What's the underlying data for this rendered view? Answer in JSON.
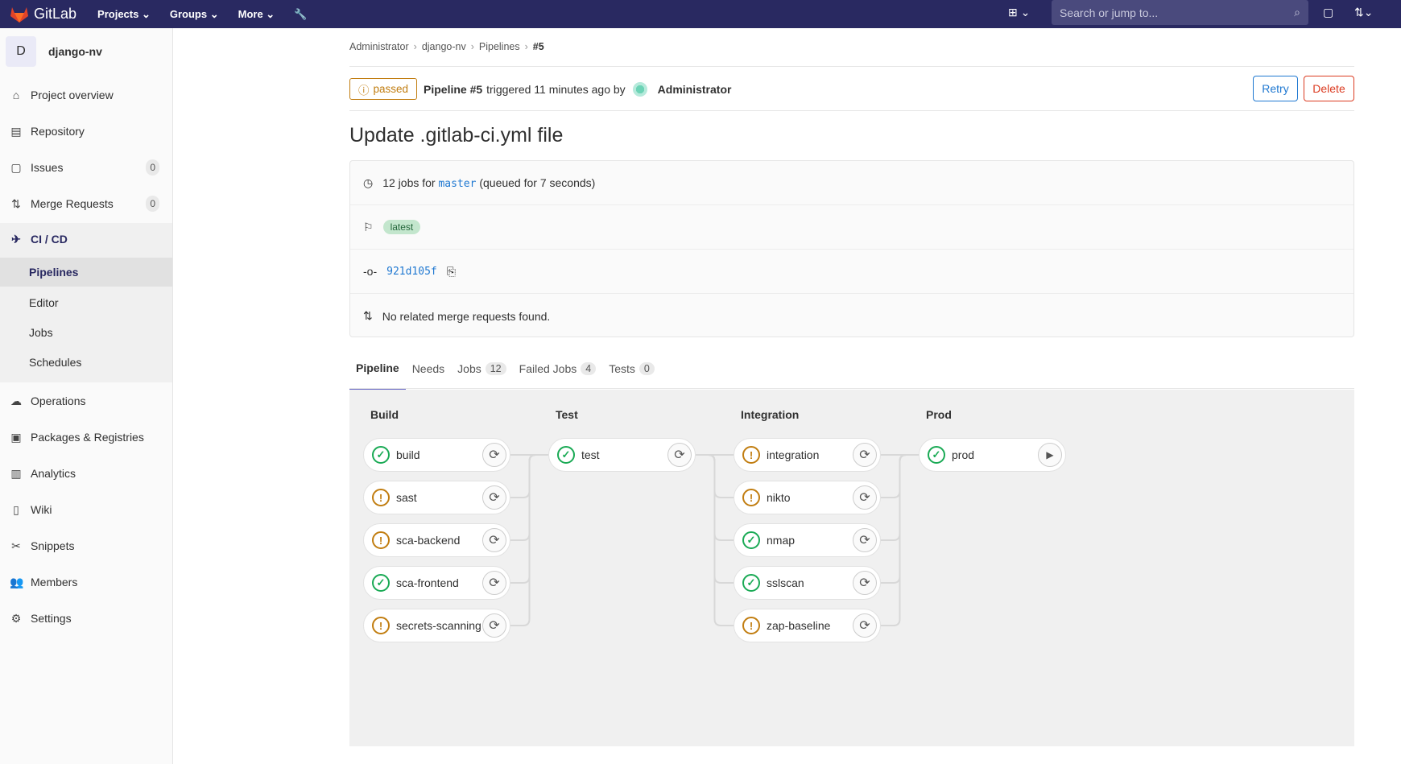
{
  "topbar": {
    "brand": "GitLab",
    "nav": [
      "Projects",
      "Groups",
      "More"
    ],
    "search_placeholder": "Search or jump to..."
  },
  "sidebar": {
    "project_initial": "D",
    "project_name": "django-nv",
    "items": [
      {
        "label": "Project overview",
        "icon": "home-icon"
      },
      {
        "label": "Repository",
        "icon": "doc-icon"
      },
      {
        "label": "Issues",
        "icon": "issues-icon",
        "count": "0"
      },
      {
        "label": "Merge Requests",
        "icon": "merge-request-icon",
        "count": "0"
      },
      {
        "label": "CI / CD",
        "icon": "rocket-icon"
      }
    ],
    "ci_sub": [
      "Pipelines",
      "Editor",
      "Jobs",
      "Schedules"
    ],
    "items2": [
      {
        "label": "Operations",
        "icon": "cloud-gear-icon"
      },
      {
        "label": "Packages & Registries",
        "icon": "package-icon"
      },
      {
        "label": "Analytics",
        "icon": "chart-icon"
      },
      {
        "label": "Wiki",
        "icon": "book-icon"
      },
      {
        "label": "Snippets",
        "icon": "scissors-icon"
      },
      {
        "label": "Members",
        "icon": "users-icon"
      },
      {
        "label": "Settings",
        "icon": "gear-icon"
      }
    ]
  },
  "breadcrumb": [
    "Administrator",
    "django-nv",
    "Pipelines",
    "#5"
  ],
  "header": {
    "status": "passed",
    "pipeline": "Pipeline #5",
    "triggered": "triggered 11 minutes ago by",
    "user": "Administrator",
    "retry": "Retry",
    "delete": "Delete"
  },
  "title": "Update .gitlab-ci.yml file",
  "info": {
    "jobs_count": "12 jobs for",
    "branch": "master",
    "queued": "(queued for 7 seconds)",
    "tag": "latest",
    "commit": "921d105f",
    "mr": "No related merge requests found."
  },
  "tabs": [
    {
      "label": "Pipeline"
    },
    {
      "label": "Needs"
    },
    {
      "label": "Jobs",
      "count": "12"
    },
    {
      "label": "Failed Jobs",
      "count": "4"
    },
    {
      "label": "Tests",
      "count": "0"
    }
  ],
  "stages": [
    {
      "name": "Build",
      "jobs": [
        {
          "name": "build",
          "status": "success"
        },
        {
          "name": "sast",
          "status": "warning"
        },
        {
          "name": "sca-backend",
          "status": "warning"
        },
        {
          "name": "sca-frontend",
          "status": "success"
        },
        {
          "name": "secrets-scanning",
          "status": "warning"
        }
      ]
    },
    {
      "name": "Test",
      "jobs": [
        {
          "name": "test",
          "status": "success"
        }
      ]
    },
    {
      "name": "Integration",
      "jobs": [
        {
          "name": "integration",
          "status": "warning"
        },
        {
          "name": "nikto",
          "status": "warning"
        },
        {
          "name": "nmap",
          "status": "success"
        },
        {
          "name": "sslscan",
          "status": "success"
        },
        {
          "name": "zap-baseline",
          "status": "warning"
        }
      ]
    },
    {
      "name": "Prod",
      "jobs": [
        {
          "name": "prod",
          "status": "success",
          "action": "play"
        }
      ]
    }
  ],
  "colors": {
    "topbar": "#292961",
    "success": "#1aaa55",
    "warning": "#c17d10",
    "link": "#1f78d1",
    "danger": "#db3b21"
  }
}
